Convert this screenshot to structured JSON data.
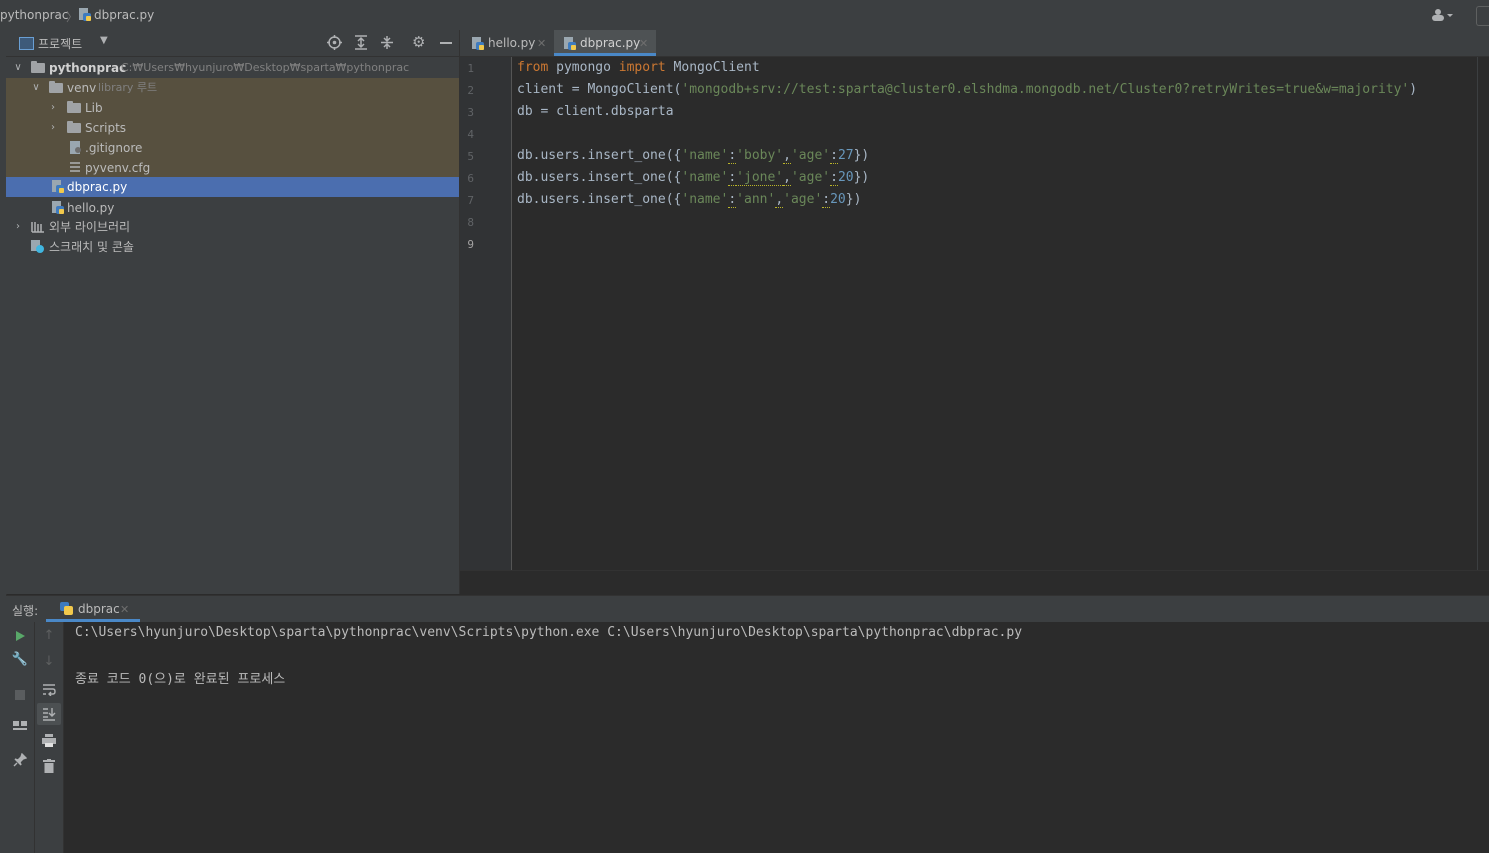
{
  "breadcrumb": {
    "project": "pythonprac",
    "file": "dbprac.py"
  },
  "project_panel": {
    "view_label": "프로젝트",
    "tree": {
      "root": {
        "name": "pythonprac",
        "path": "C:₩Users₩hyunjuro₩Desktop₩sparta₩pythonprac"
      },
      "venv": {
        "name": "venv",
        "hint": "library 루트"
      },
      "lib": "Lib",
      "scripts": "Scripts",
      "gitignore": ".gitignore",
      "pyvenv": "pyvenv.cfg",
      "dbprac": "dbprac.py",
      "hello": "hello.py",
      "external": "외부 라이브러리",
      "scratch": "스크래치 및 콘솔"
    }
  },
  "editor": {
    "tabs": [
      {
        "label": "hello.py",
        "active": false
      },
      {
        "label": "dbprac.py",
        "active": true
      }
    ],
    "line_numbers": [
      "1",
      "2",
      "3",
      "4",
      "5",
      "6",
      "7",
      "8",
      "9"
    ],
    "current_line": 9,
    "code": {
      "l1": {
        "kw1": "from",
        "mod": " pymongo ",
        "kw2": "import",
        "rest": " MongoClient"
      },
      "l2": {
        "pre": "client = MongoClient(",
        "str": "'mongodb+srv://test:sparta@cluster0.elshdma.mongodb.net/Cluster0?retryWrites=true&w=majority'",
        "post": ")"
      },
      "l3": "db = client.dbsparta",
      "l5": {
        "pre": "db.users.insert_one({",
        "k1": "'name'",
        "c1": ":",
        "v1": "'boby'",
        "c2": ",",
        "k2": "'age'",
        "c3": ":",
        "n": "27",
        "post": "})"
      },
      "l6": {
        "pre": "db.users.insert_one({",
        "k1": "'name'",
        "c1": ":",
        "v1": "'jone'",
        "c2": ",",
        "k2": "'age'",
        "c3": ":",
        "n": "20",
        "post": "})"
      },
      "l7": {
        "pre": "db.users.insert_one({",
        "k1": "'name'",
        "c1": ":",
        "v1": "'ann'",
        "c2": ",",
        "k2": "'age'",
        "c3": ":",
        "n": "20",
        "post": "})"
      }
    }
  },
  "run_panel": {
    "label": "실행:",
    "tab": "dbprac",
    "output": [
      "C:\\Users\\hyunjuro\\Desktop\\sparta\\pythonprac\\venv\\Scripts\\python.exe C:\\Users\\hyunjuro\\Desktop\\sparta\\pythonprac\\dbprac.py",
      "",
      "종료 코드 0(으)로 완료된 프로세스"
    ]
  },
  "colors": {
    "keyword": "#cc7832",
    "string": "#6a8759",
    "number": "#6897bb",
    "selection": "#4b6eaf",
    "venv_highlight": "#57503f",
    "run_icon": "#59a869"
  },
  "icons": [
    "folder-icon",
    "python-file-icon",
    "settings-icon",
    "locate-icon",
    "expand-all-icon",
    "collapse-all-icon",
    "minimize-icon",
    "run-icon",
    "wrench-icon",
    "stop-icon",
    "pin-icon",
    "print-icon",
    "trash-icon",
    "soft-wrap-icon",
    "scroll-to-end-icon",
    "user-icon"
  ]
}
